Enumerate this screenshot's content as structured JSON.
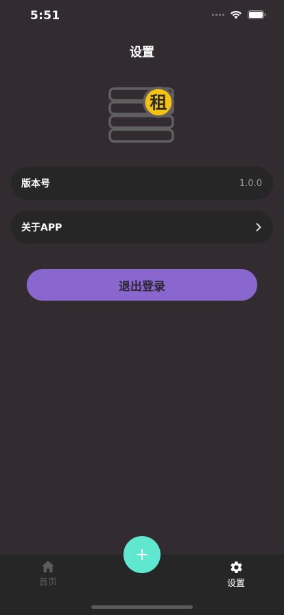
{
  "status_bar": {
    "time": "5:51"
  },
  "header": {
    "title": "设置"
  },
  "logo": {
    "badge_text": "租",
    "badge_color": "#f5c20e",
    "stack_color": "#5f5f5f"
  },
  "settings": {
    "version": {
      "label": "版本号",
      "value": "1.0.0"
    },
    "about": {
      "label": "关于APP"
    }
  },
  "logout": {
    "label": "退出登录",
    "color": "#8a67cf"
  },
  "tabbar": {
    "home": {
      "label": "首页",
      "icon": "home-icon"
    },
    "settings": {
      "label": "设置",
      "icon": "gear-icon"
    },
    "add": {
      "icon": "plus-icon",
      "color": "#5fe8cf"
    }
  }
}
